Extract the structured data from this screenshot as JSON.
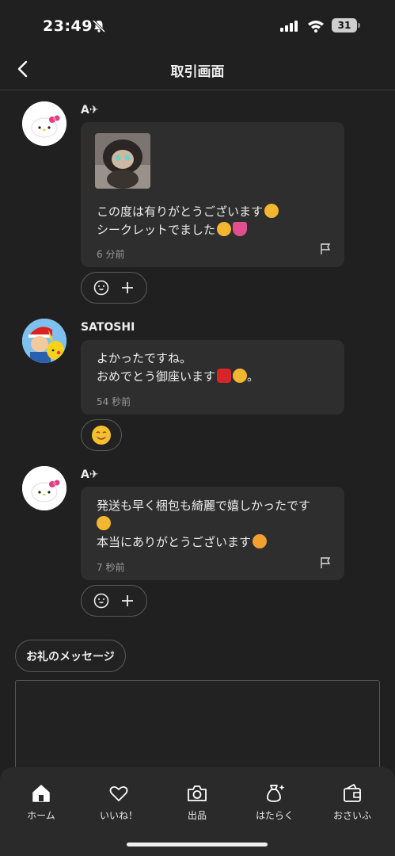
{
  "status_bar": {
    "time": "23:49",
    "battery": "31"
  },
  "header": {
    "title": "取引画面"
  },
  "messages": [
    {
      "sender": "A✈",
      "lines": [
        "この度は有りがとうございます",
        "シークレットでました"
      ],
      "time": "6 分前"
    },
    {
      "sender": "SATOSHI",
      "lines": [
        "よかったですね。",
        "おめでとう御座います",
        "。"
      ],
      "time": "54 秒前"
    },
    {
      "sender": "A✈",
      "lines": [
        "発送も早く梱包も綺麗で嬉しかったです",
        "本当にありがとうございます"
      ],
      "time": "7 秒前"
    }
  ],
  "thanks": {
    "label": "お礼のメッセージ"
  },
  "nav": {
    "items": [
      {
        "label": "ホーム",
        "icon": "home-icon"
      },
      {
        "label": "いいね！",
        "icon": "heart-icon"
      },
      {
        "label": "出品",
        "icon": "camera-icon"
      },
      {
        "label": "はたらく",
        "icon": "money-bag-icon"
      },
      {
        "label": "おさいふ",
        "icon": "wallet-icon"
      }
    ]
  },
  "colors": {
    "background": "#202020",
    "bubble": "#2e2e2e",
    "nav": "#2a2a2a",
    "text": "#ececec",
    "muted": "#9a9a9a"
  }
}
